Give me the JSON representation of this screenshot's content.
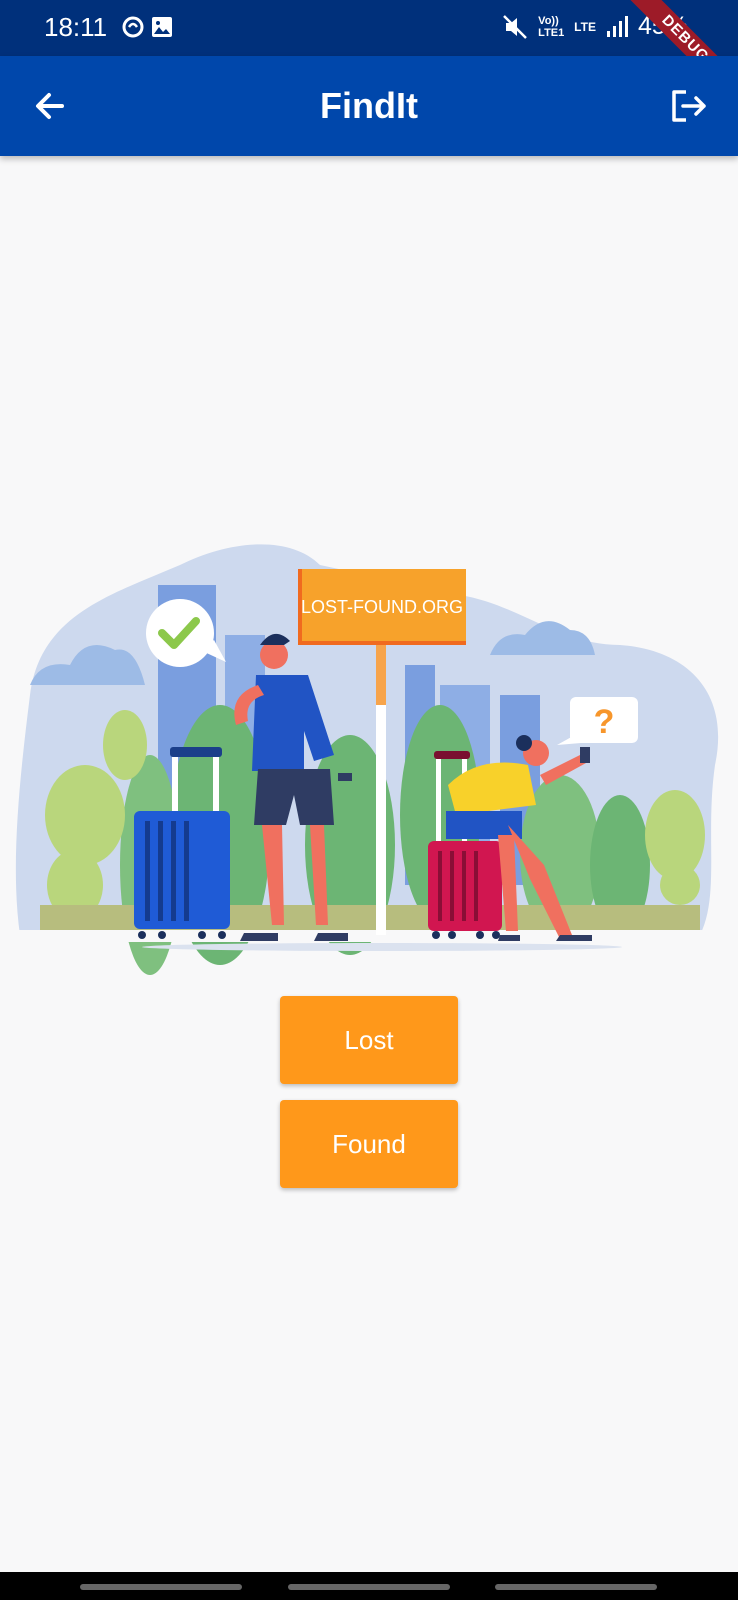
{
  "status_bar": {
    "time": "18:11",
    "battery": "45%",
    "network": "LTE",
    "volte": "Vo)) LTE1"
  },
  "debug_banner": "DEBUG",
  "app_bar": {
    "title": "FindIt",
    "back_icon": "arrow-left-icon",
    "logout_icon": "logout-icon"
  },
  "illustration": {
    "sign_text": "LOST-FOUND.ORG",
    "bubble_question": "?"
  },
  "actions": {
    "lost_label": "Lost",
    "found_label": "Found"
  },
  "colors": {
    "status_bar": "#00307b",
    "app_bar": "#0047ab",
    "button": "#ff981a",
    "background": "#f8f8f9"
  }
}
